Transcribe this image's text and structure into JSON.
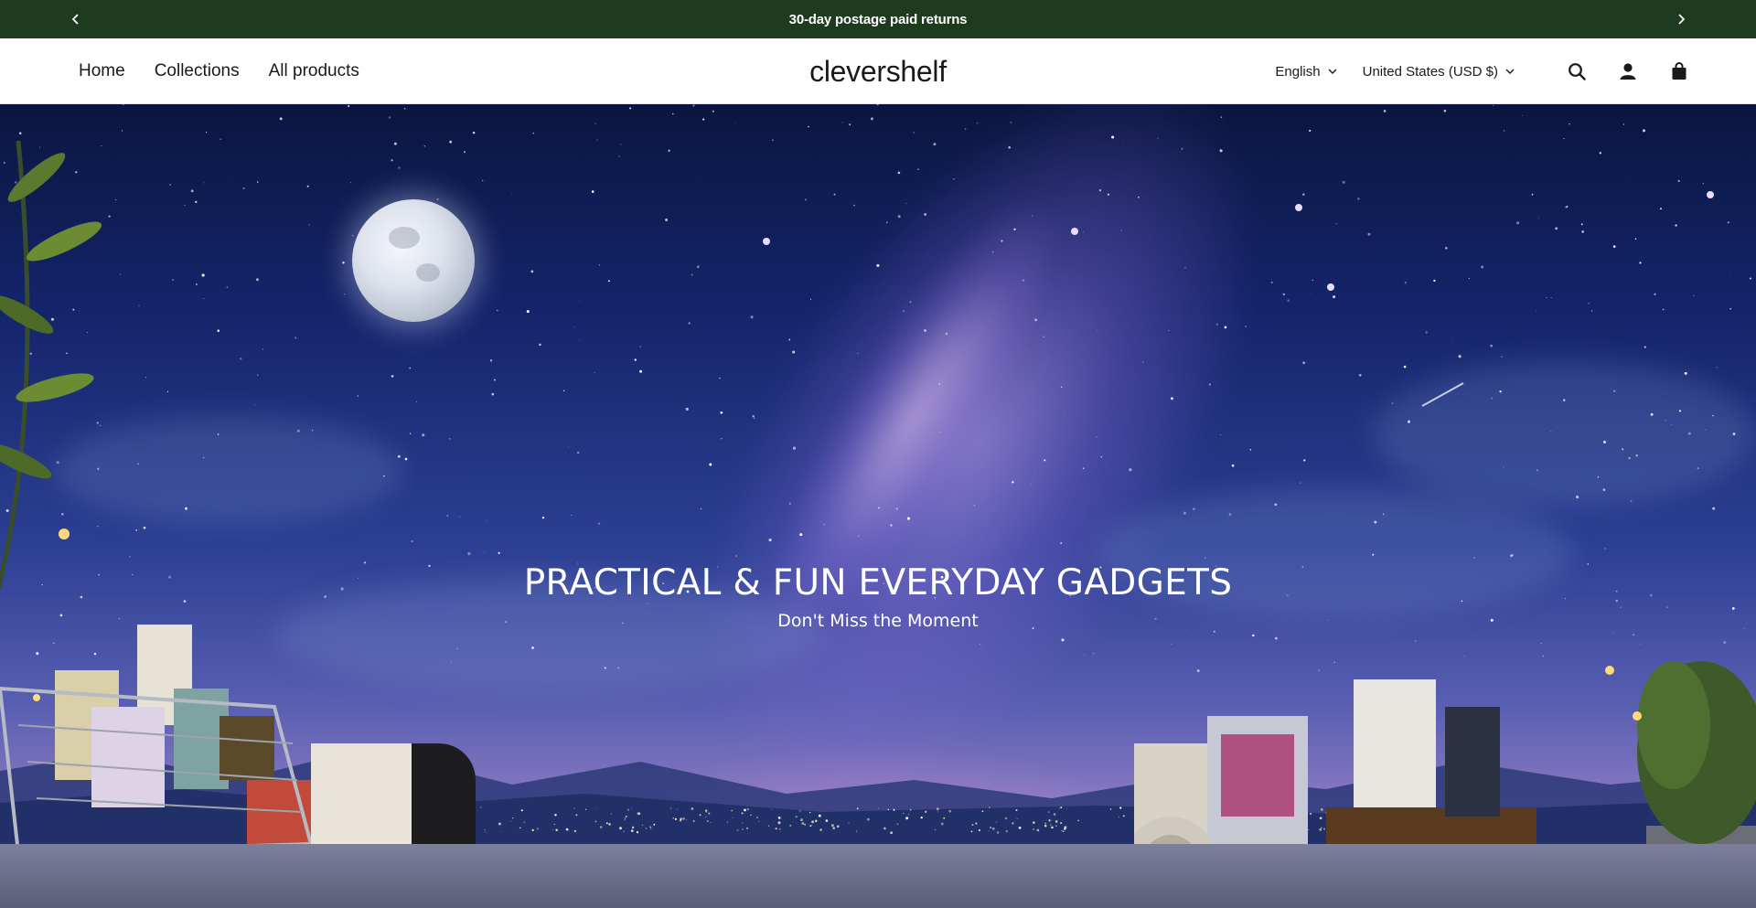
{
  "announcement": {
    "text": "30-day postage paid returns",
    "prev_icon": "chevron-left-icon",
    "next_icon": "chevron-right-icon",
    "background": "#1e3a1f"
  },
  "header": {
    "nav": [
      {
        "label": "Home"
      },
      {
        "label": "Collections"
      },
      {
        "label": "All products"
      }
    ],
    "logo": "clevershelf",
    "language": "English",
    "country": "United States (USD $)",
    "icons": [
      "search-icon",
      "account-icon",
      "cart-icon"
    ]
  },
  "hero": {
    "title": "PRACTICAL & FUN EVERYDAY GADGETS",
    "subtitle": "Don't Miss the Moment"
  }
}
